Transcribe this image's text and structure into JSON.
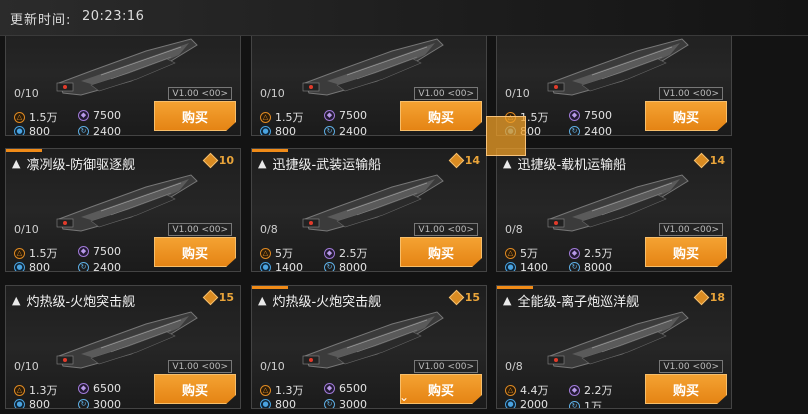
{
  "header": {
    "title": "更新时间:",
    "time": "20:23:16"
  },
  "buy_label": "购买",
  "accent": "#f08b18",
  "cards": [
    {
      "name": "",
      "level": "",
      "count": "0/10",
      "version": "V1.00 <00>",
      "c1": "1.5万",
      "c2": "7500",
      "c3": "800",
      "c4": "2400"
    },
    {
      "name": "",
      "level": "",
      "count": "0/10",
      "version": "V1.00 <00>",
      "c1": "1.5万",
      "c2": "7500",
      "c3": "800",
      "c4": "2400"
    },
    {
      "name": "",
      "level": "",
      "count": "0/10",
      "version": "V1.00 <00>",
      "c1": "1.5万",
      "c2": "7500",
      "c3": "800",
      "c4": "2400"
    },
    {
      "name": "凛冽级-防御驱逐舰",
      "level": "10",
      "count": "0/10",
      "version": "V1.00 <00>",
      "c1": "1.5万",
      "c2": "7500",
      "c3": "800",
      "c4": "2400"
    },
    {
      "name": "迅捷级-武装运输船",
      "level": "14",
      "count": "0/8",
      "version": "V1.00 <00>",
      "c1": "5万",
      "c2": "2.5万",
      "c3": "1400",
      "c4": "8000"
    },
    {
      "name": "迅捷级-载机运输船",
      "level": "14",
      "count": "0/8",
      "version": "V1.00 <00>",
      "c1": "5万",
      "c2": "2.5万",
      "c3": "1400",
      "c4": "8000"
    },
    {
      "name": "灼热级-火炮突击舰",
      "level": "15",
      "count": "0/10",
      "version": "V1.00 <00>",
      "c1": "1.3万",
      "c2": "6500",
      "c3": "800",
      "c4": "3000"
    },
    {
      "name": "灼热级-火炮突击舰",
      "level": "15",
      "count": "0/10",
      "version": "V1.00 <00>",
      "c1": "1.3万",
      "c2": "6500",
      "c3": "800",
      "c4": "3000"
    },
    {
      "name": "全能级-离子炮巡洋舰",
      "level": "18",
      "count": "0/8",
      "version": "V1.00 <00>",
      "c1": "4.4万",
      "c2": "2.2万",
      "c3": "2000",
      "c4": "1万"
    }
  ],
  "icons": {
    "scroll": "chevron-down-icon"
  }
}
